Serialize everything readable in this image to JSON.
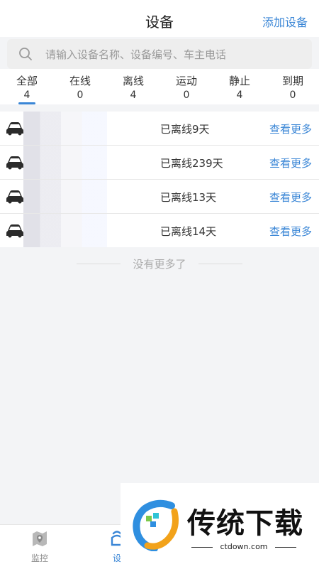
{
  "header": {
    "title": "设备",
    "add_label": "添加设备"
  },
  "search": {
    "placeholder": "请输入设备名称、设备编号、车主电话"
  },
  "tabs": [
    {
      "label": "全部",
      "count": "4"
    },
    {
      "label": "在线",
      "count": "0"
    },
    {
      "label": "离线",
      "count": "4"
    },
    {
      "label": "运动",
      "count": "0"
    },
    {
      "label": "静止",
      "count": "4"
    },
    {
      "label": "到期",
      "count": "0"
    }
  ],
  "devices": [
    {
      "status": "已离线9天",
      "more": "查看更多"
    },
    {
      "status": "已离线239天",
      "more": "查看更多"
    },
    {
      "status": "已离线13天",
      "more": "查看更多"
    },
    {
      "status": "已离线14天",
      "more": "查看更多"
    }
  ],
  "list_footer": "没有更多了",
  "bottom_nav": [
    {
      "label": "监控",
      "icon": "map-pin-icon"
    },
    {
      "label": "设",
      "icon": "device-icon"
    }
  ],
  "watermark": {
    "text": "传统下载",
    "url": "ctdown.com"
  },
  "colors": {
    "accent": "#3a86d6",
    "background": "#f3f4f6"
  }
}
